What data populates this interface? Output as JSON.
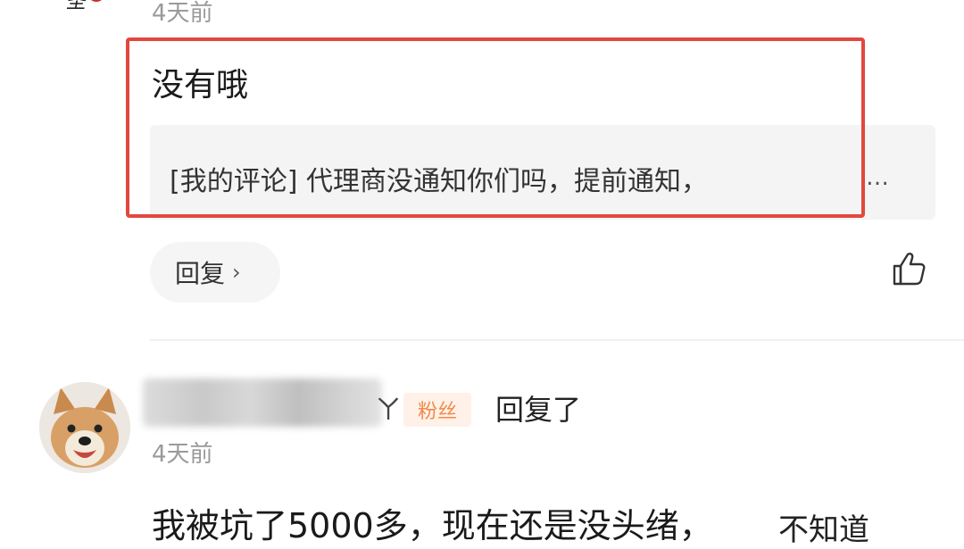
{
  "top_comment": {
    "time": "4天前",
    "reply_text": "没有哦",
    "quoted": {
      "text": "[我的评论] 代理商没通知你们吗，提前通知，",
      "ellipsis": "…"
    },
    "reply_button_label": "回复",
    "reply_chevron": "›",
    "like_icon": "thumbs-up-icon",
    "highlight_color": "#e2473e"
  },
  "next_comment": {
    "username_tail": "ㄚ",
    "fan_badge": "粉丝",
    "action": "回复了",
    "time": "4天前",
    "text": "我被坑了5000多，现在还是没头绪，",
    "text_tail": "不知道"
  },
  "colors": {
    "badge_text": "#f08a4b",
    "badge_bg": "#fff1e8",
    "time": "#9a9a9a"
  }
}
